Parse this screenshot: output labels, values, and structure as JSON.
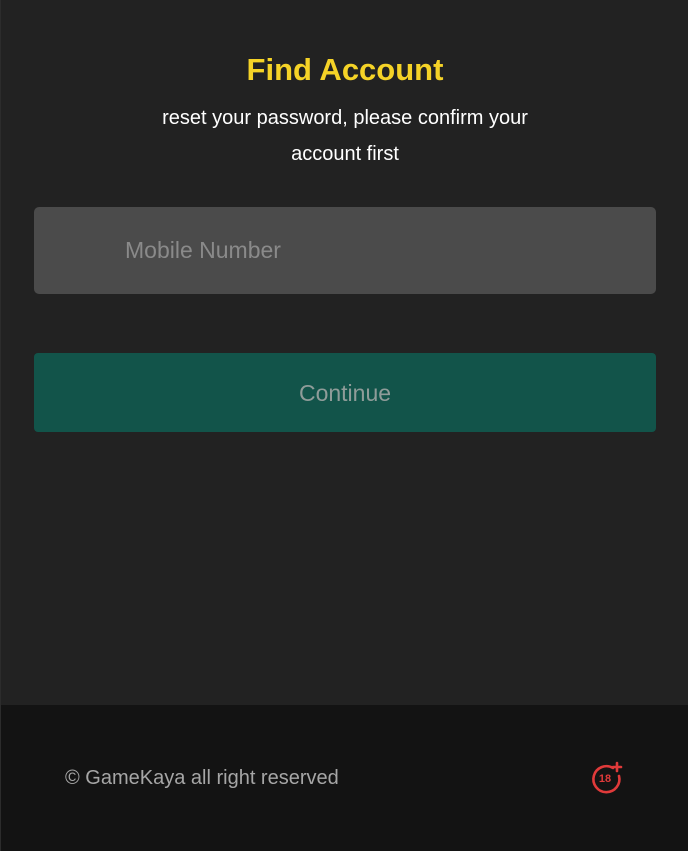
{
  "page": {
    "title": "Find Account",
    "subtitle": "reset your password, please confirm your account first"
  },
  "form": {
    "mobile_placeholder": "Mobile Number",
    "mobile_value": "",
    "continue_label": "Continue"
  },
  "footer": {
    "copyright": "© GameKaya all right reserved",
    "age_badge": "18"
  },
  "colors": {
    "background": "#222222",
    "title": "#f5d327",
    "input_background": "#4b4b4b",
    "button_background": "#12544a",
    "footer_background": "#131313",
    "age_icon": "#e03a3a"
  },
  "icons": {
    "age_restriction": "age-18-plus-icon"
  }
}
